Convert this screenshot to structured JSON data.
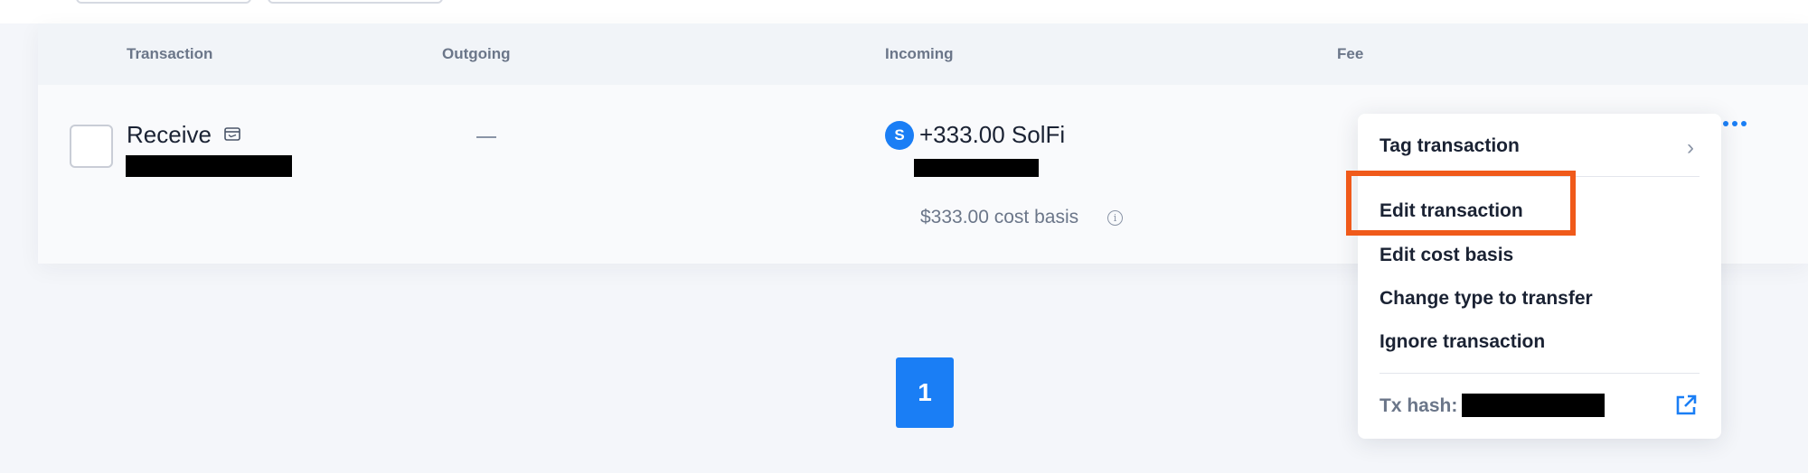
{
  "table": {
    "headers": {
      "transaction": "Transaction",
      "outgoing": "Outgoing",
      "incoming": "Incoming",
      "fee": "Fee"
    },
    "row": {
      "type": "Receive",
      "type_icon": "wallet-icon",
      "outgoing": "—",
      "token_badge": "S",
      "incoming_amount": "+333.00 SolFi",
      "cost_basis": "$333.00 cost basis",
      "info_icon": "info-icon",
      "more_icon": "more-horizontal-icon"
    }
  },
  "menu": {
    "items": [
      {
        "label": "Tag transaction",
        "icon": "chevron-right-icon"
      },
      {
        "label": "Edit transaction"
      },
      {
        "label": "Edit cost basis"
      },
      {
        "label": "Change type to transfer"
      },
      {
        "label": "Ignore transaction"
      }
    ],
    "tx_hash_label": "Tx hash:",
    "tx_hash_icon": "external-link-icon"
  },
  "pagination": {
    "current_page": "1"
  },
  "colors": {
    "accent": "#1a7ef5",
    "highlight": "#f05a1a",
    "text": "#1a2233",
    "muted": "#6b7689"
  }
}
